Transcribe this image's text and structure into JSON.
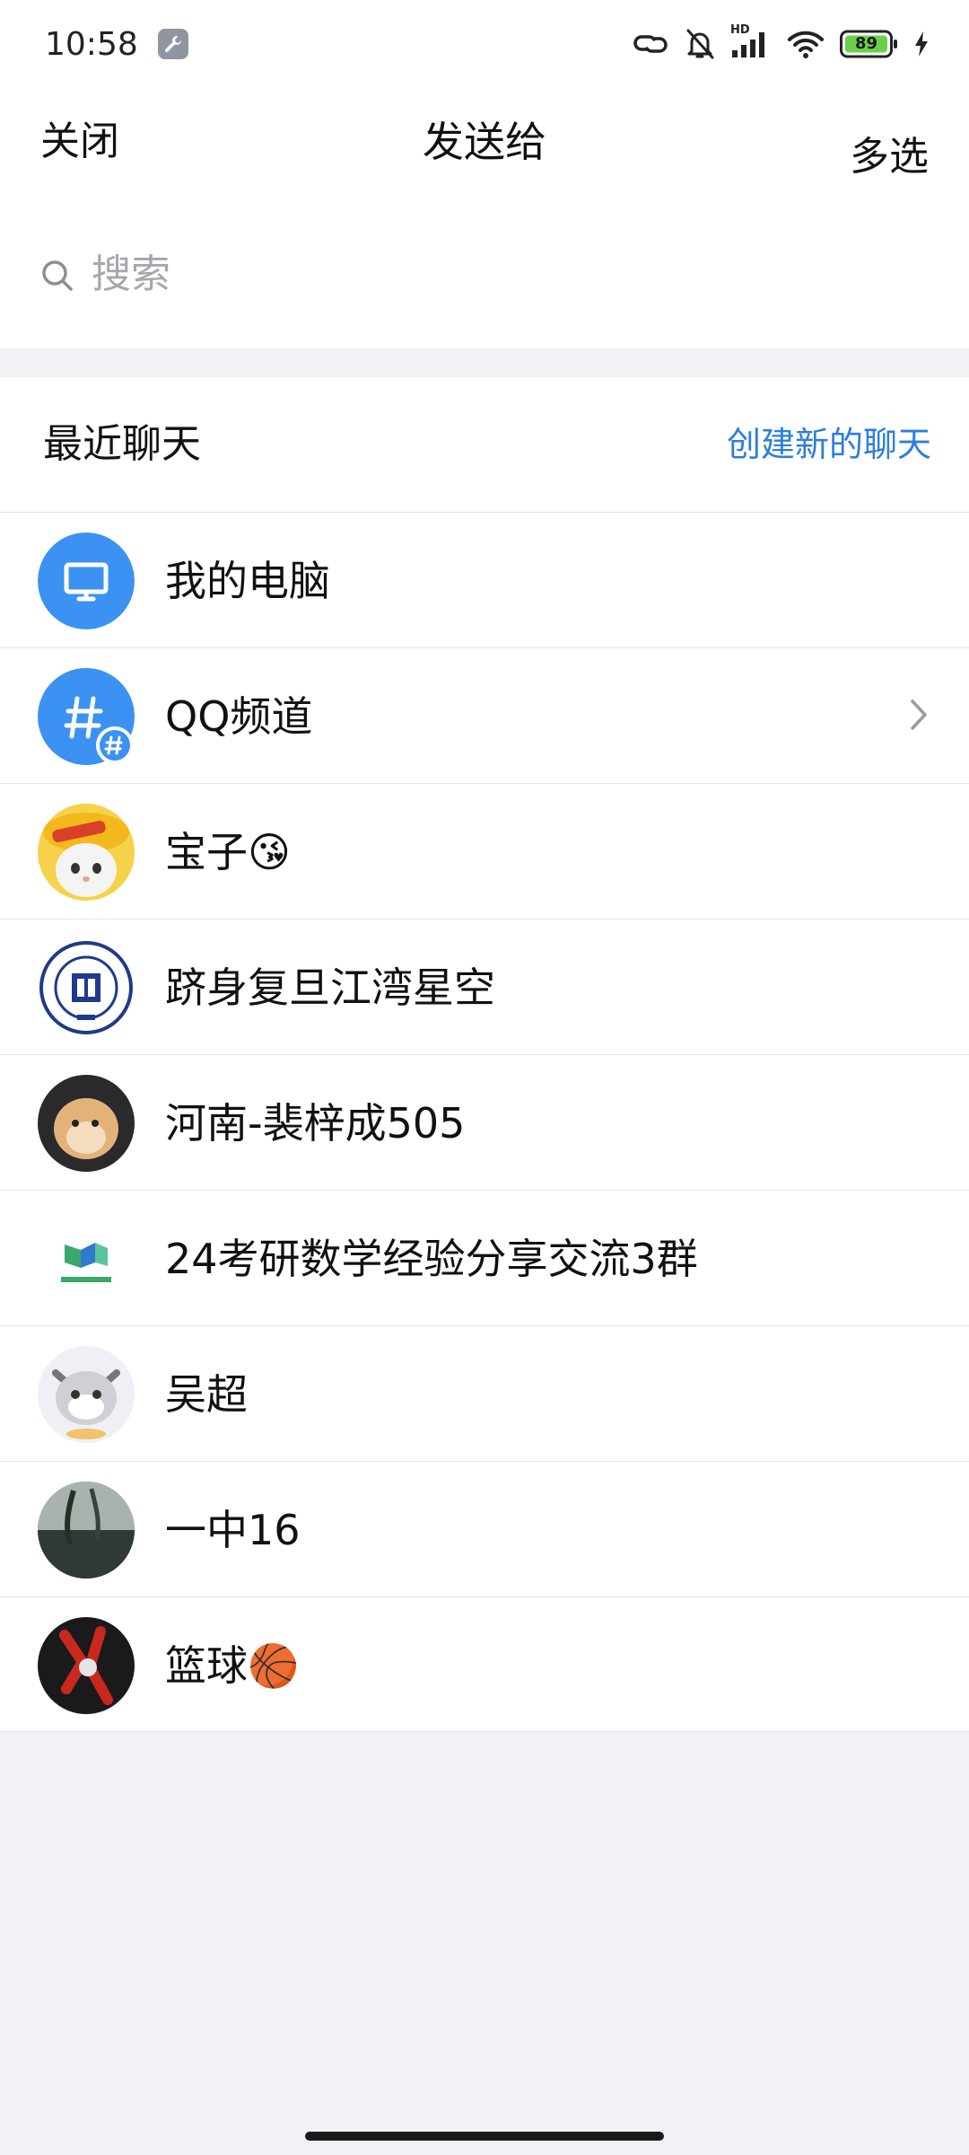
{
  "status": {
    "time": "10:58",
    "battery": "89",
    "network": "HD"
  },
  "nav": {
    "close": "关闭",
    "title": "发送给",
    "multi_select": "多选"
  },
  "search": {
    "placeholder": "搜索"
  },
  "section": {
    "title": "最近聊天",
    "create_chat": "创建新的聊天"
  },
  "chats": [
    {
      "name": "我的电脑",
      "avatar": "computer-icon"
    },
    {
      "name": "QQ频道",
      "avatar": "channel-hash-icon"
    },
    {
      "name": "宝子😘",
      "avatar": "cat-photo"
    },
    {
      "name": "跻身复旦江湾星空",
      "avatar": "fudan-university-seal"
    },
    {
      "name": "河南-裴梓成505",
      "avatar": "hamster-photo"
    },
    {
      "name": "24考研数学经验分享交流3群",
      "avatar": "mooc-kaoyan-logo"
    },
    {
      "name": "吴超",
      "avatar": "cartoon-cat"
    },
    {
      "name": "一中16",
      "avatar": "lake-photo"
    },
    {
      "name": "篮球🏀",
      "avatar": "dark-art-photo"
    }
  ],
  "colors": {
    "accent": "#2d7de0",
    "qq_blue": "#3b92f3",
    "battery_green": "#6ad04a",
    "background": "#f1f1f6"
  }
}
